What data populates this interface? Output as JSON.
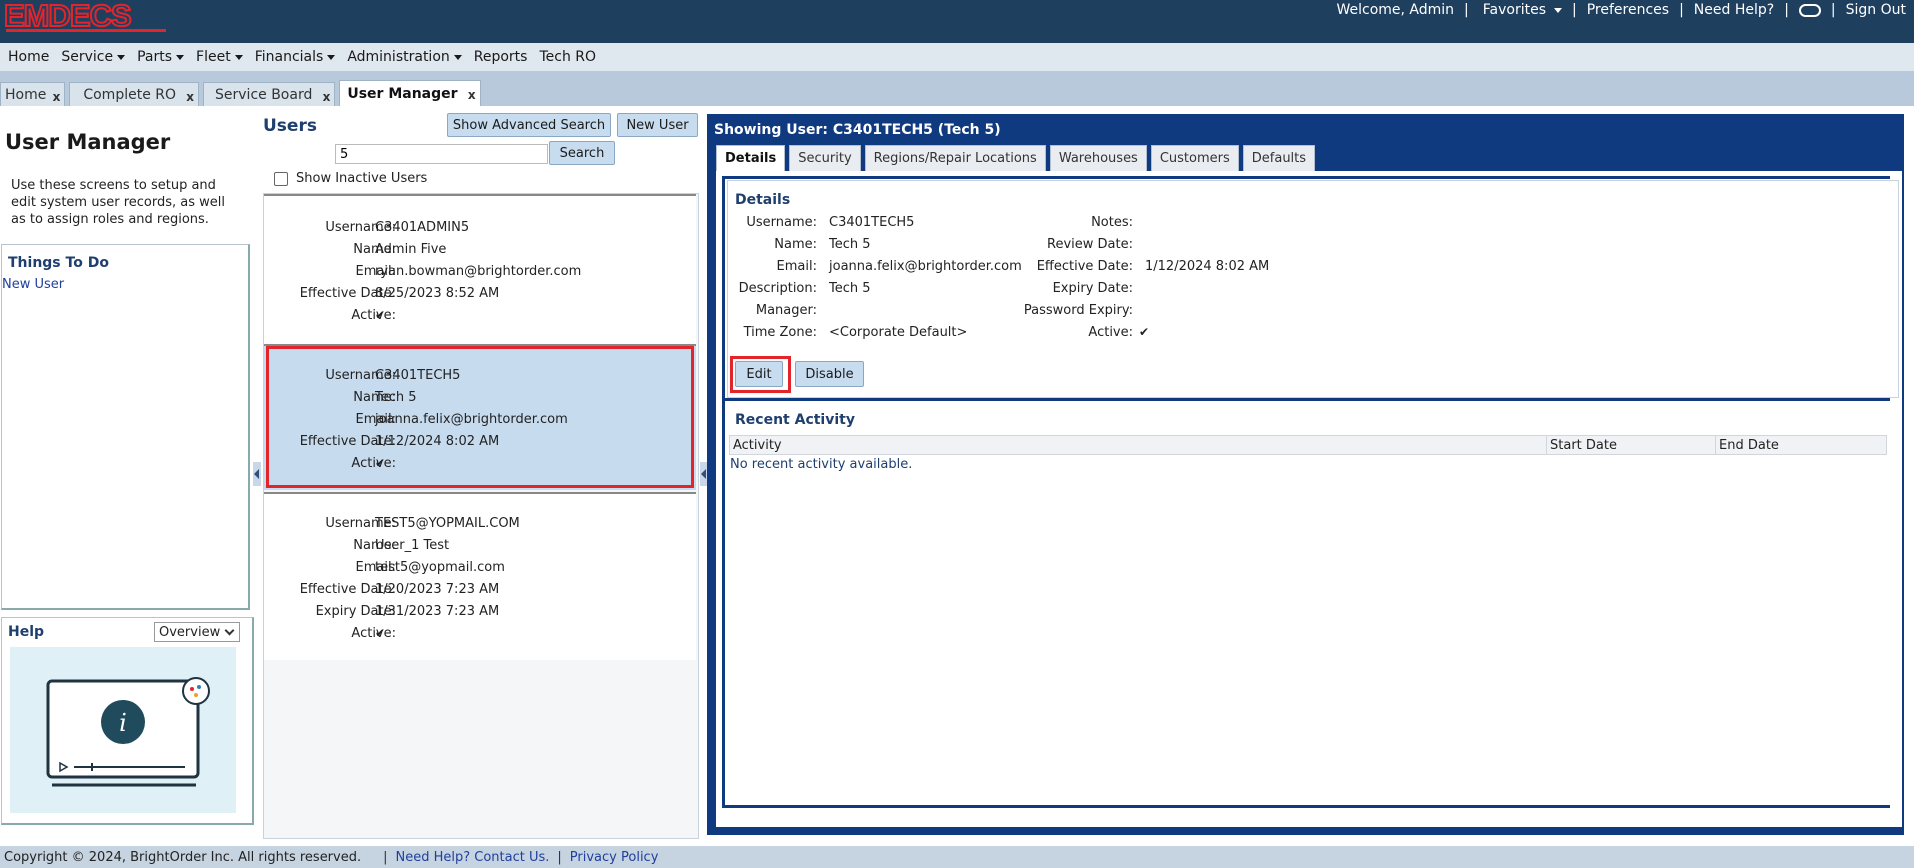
{
  "app": {
    "logo_text": "EMDECS",
    "welcome": "Welcome, Admin",
    "favorites": "Favorites",
    "preferences": "Preferences",
    "need_help": "Need Help?",
    "sign_out": "Sign Out",
    "separator": "|"
  },
  "nav": {
    "items": [
      {
        "label": "Home",
        "dropdown": false
      },
      {
        "label": "Service",
        "dropdown": true
      },
      {
        "label": "Parts",
        "dropdown": true
      },
      {
        "label": "Fleet",
        "dropdown": true
      },
      {
        "label": "Financials",
        "dropdown": true
      },
      {
        "label": "Administration",
        "dropdown": true
      },
      {
        "label": "Reports",
        "dropdown": false
      },
      {
        "label": "Tech RO",
        "dropdown": false
      }
    ]
  },
  "tabs": [
    {
      "label": "Home",
      "close": "x"
    },
    {
      "label": "Complete RO",
      "close": "x"
    },
    {
      "label": "Service Board",
      "close": "x"
    },
    {
      "label": "User Manager",
      "close": "x",
      "active": true
    }
  ],
  "left": {
    "title": "User Manager",
    "description": "Use these screens to setup and edit system user records, as well as to assign roles and regions.",
    "things_to_do_title": "Things To Do",
    "things_to_do_link": "New User",
    "help_title": "Help",
    "help_select_value": "Overview",
    "info_glyph": "i"
  },
  "users": {
    "title": "Users",
    "show_advanced_search": "Show Advanced Search",
    "new_user": "New User",
    "search_value": "5",
    "search_button": "Search",
    "show_inactive_label": "Show Inactive Users",
    "show_inactive_checked": false,
    "labels": {
      "username": "Username:",
      "name": "Name:",
      "email": "Email:",
      "effective_date": "Effective Date:",
      "expiry_date": "Expiry Date:",
      "active": "Active:"
    },
    "active_check": "✔",
    "list": [
      {
        "username": "C3401ADMIN5",
        "name": "Admin Five",
        "email": "ryan.bowman@brightorder.com",
        "effective_date": "8/25/2023 8:52 AM",
        "expiry_date": "",
        "active": true,
        "selected": false
      },
      {
        "username": "C3401TECH5",
        "name": "Tech 5",
        "email": "joanna.felix@brightorder.com",
        "effective_date": "1/12/2024 8:02 AM",
        "expiry_date": "",
        "active": true,
        "selected": true
      },
      {
        "username": "TEST5@YOPMAIL.COM",
        "name": "User_1 Test",
        "email": "test5@yopmail.com",
        "effective_date": "1/20/2023 7:23 AM",
        "expiry_date": "1/31/2023 7:23 AM",
        "active": true,
        "selected": false
      }
    ]
  },
  "detail": {
    "title": "Showing User: C3401TECH5 (Tech 5)",
    "tabs": [
      "Details",
      "Security",
      "Regions/Repair Locations",
      "Warehouses",
      "Customers",
      "Defaults"
    ],
    "section_title": "Details",
    "left_fields": [
      {
        "label": "Username:",
        "value": "C3401TECH5"
      },
      {
        "label": "Name:",
        "value": "Tech 5"
      },
      {
        "label": "Email:",
        "value": "joanna.felix@brightorder.com"
      },
      {
        "label": "Description:",
        "value": "Tech 5"
      },
      {
        "label": "Manager:",
        "value": ""
      },
      {
        "label": "Time Zone:",
        "value": "<Corporate Default>"
      }
    ],
    "right_fields": [
      {
        "label": "Notes:",
        "value": ""
      },
      {
        "label": "Review Date:",
        "value": ""
      },
      {
        "label": "Effective Date:",
        "value": "1/12/2024 8:02 AM"
      },
      {
        "label": "Expiry Date:",
        "value": ""
      },
      {
        "label": "Password Expiry:",
        "value": ""
      },
      {
        "label": "Active:",
        "value": "✔"
      }
    ],
    "edit_button": "Edit",
    "disable_button": "Disable",
    "recent_title": "Recent Activity",
    "recent_columns": [
      "Activity",
      "Start Date",
      "End Date"
    ],
    "recent_empty": "No recent activity available."
  },
  "footer": {
    "copyright": "Copyright © 2024, BrightOrder Inc. All rights reserved.",
    "help_link": "Need Help? Contact Us.",
    "privacy_link": "Privacy Policy",
    "separator": "|"
  },
  "colors": {
    "brand_red": "#e3242b",
    "header_navy": "#1f3f5f",
    "panel_navy": "#103a80",
    "button_blue": "#c8dcef"
  }
}
